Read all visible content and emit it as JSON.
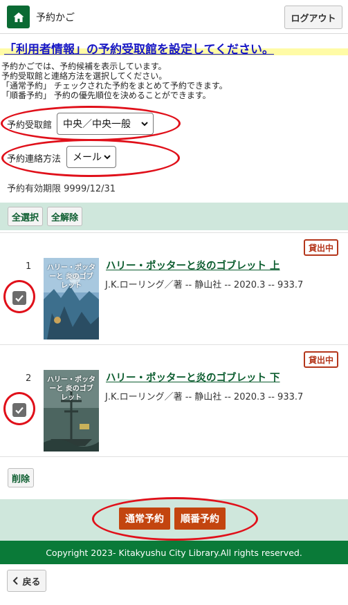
{
  "header": {
    "title": "予約かご",
    "logout_label": "ログアウト"
  },
  "notice": "「利用者情報」の予約受取館を設定してください。",
  "description": [
    "予約かごでは、予約候補を表示しています。",
    "予約受取館と連絡方法を選択してください。",
    "「通常予約」 チェックされた予約をまとめて予約できます。",
    "「順番予約」 予約の優先順位を決めることができます。"
  ],
  "pickup": {
    "label": "予約受取館",
    "value": "中央／中央一般"
  },
  "contact": {
    "label": "予約連絡方法",
    "value": "メール"
  },
  "expiry": "予約有効期限 9999/12/31",
  "select_all_label": "全選択",
  "deselect_all_label": "全解除",
  "items": [
    {
      "num": "1",
      "title": "ハリー・ポッターと炎のゴブレット 上",
      "meta": "J.K.ローリング／著 -- 静山社 -- 2020.3 -- 933.7",
      "status": "貸出中",
      "cover_title": "ハリー・ポッターと 炎のゴブレット"
    },
    {
      "num": "2",
      "title": "ハリー・ポッターと炎のゴブレット 下",
      "meta": "J.K.ローリング／著 -- 静山社 -- 2020.3 -- 933.7",
      "status": "貸出中",
      "cover_title": "ハリー・ポッターと 炎のゴブレット"
    }
  ],
  "delete_label": "削除",
  "normal_reserve_label": "通常予約",
  "order_reserve_label": "順番予約",
  "footer": "Copyright 2023- Kitakyushu City Library.All rights reserved.",
  "back_label": "戻る",
  "colors": {
    "brand_green": "#0a7a38",
    "accent_orange": "#c3450f",
    "annotation_red": "#e0101a",
    "notice_blue": "#1717c4"
  }
}
